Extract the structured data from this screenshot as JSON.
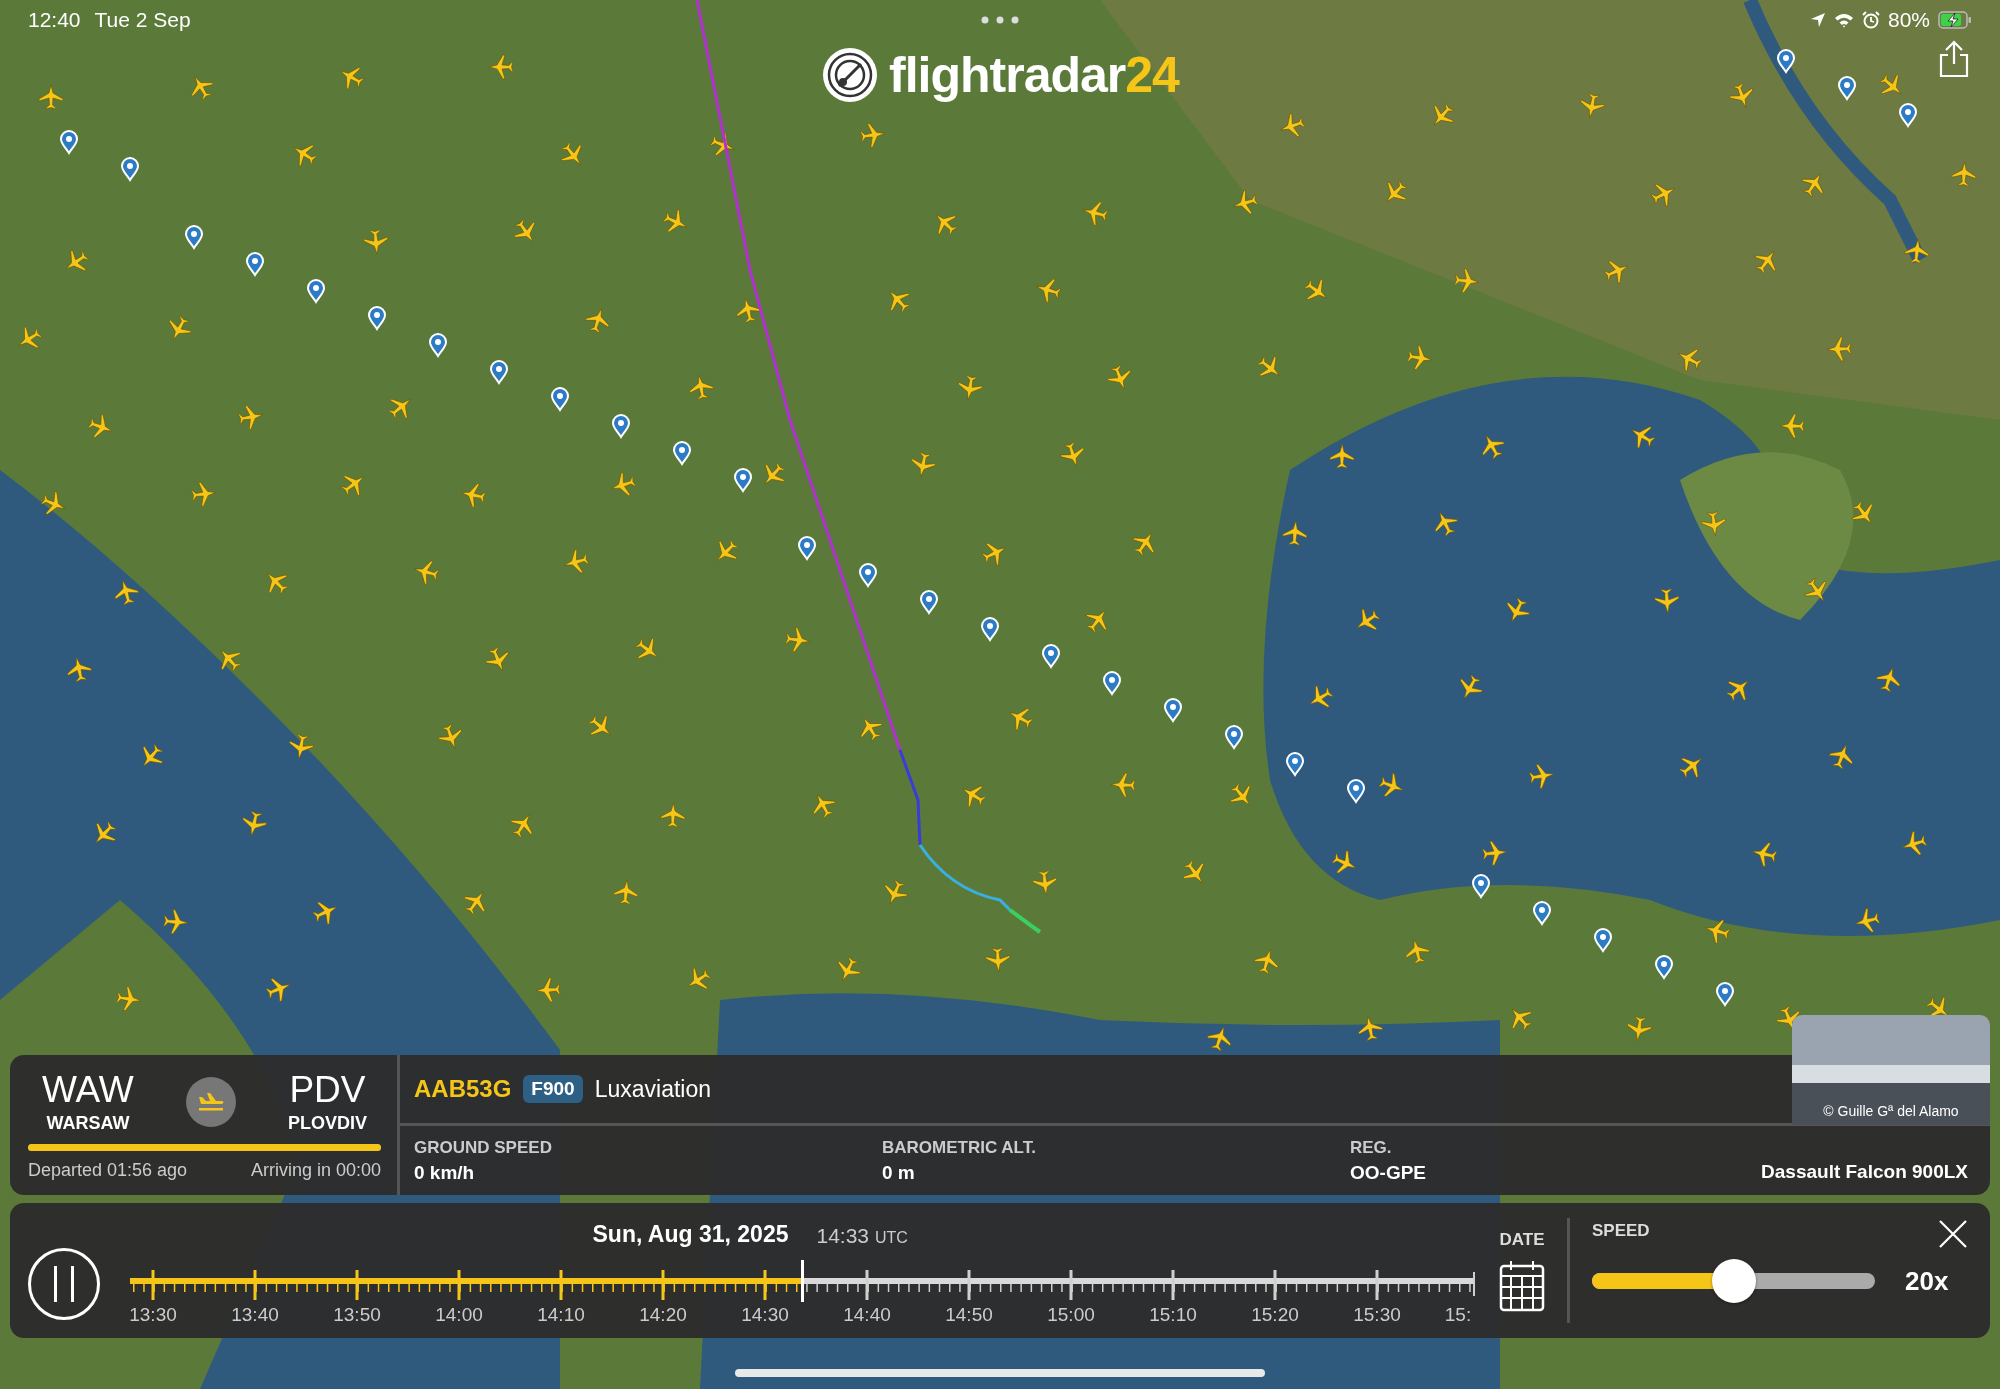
{
  "status_bar": {
    "time": "12:40",
    "date": "Tue 2 Sep",
    "battery": "80%",
    "charging": true
  },
  "logo": {
    "name": "flightradar",
    "number": "24"
  },
  "flight": {
    "origin": {
      "code": "WAW",
      "city": "WARSAW"
    },
    "destination": {
      "code": "PDV",
      "city": "PLOVDIV"
    },
    "progress": {
      "level": 1
    },
    "departed": "Departed 01:56 ago",
    "arriving": "Arriving in 00:00",
    "callsign": "AAB53G",
    "type_badge": "F900",
    "airline": "Luxaviation",
    "stats": [
      {
        "label": "GROUND SPEED",
        "value": "0 km/h"
      },
      {
        "label": "BAROMETRIC ALT.",
        "value": "0 m"
      },
      {
        "label": "REG.",
        "value": "OO-GPE"
      }
    ],
    "aircraft": "Dassault Falcon 900LX",
    "photo_credit": "© Guille Gª del Alamo"
  },
  "playback": {
    "playing": true,
    "date": "Sun, Aug 31, 2025",
    "time": "14:33",
    "zone": "UTC",
    "timeline": {
      "level": 0.5
    },
    "ticks": [
      "13:30",
      "13:40",
      "13:50",
      "14:00",
      "14:10",
      "14:20",
      "14:30",
      "14:40",
      "14:50",
      "15:00",
      "15:10",
      "15:20",
      "15:30",
      "15:"
    ],
    "date_label": "DATE",
    "speed_label": "SPEED",
    "speed": {
      "level": 0.5
    },
    "speed_value": "20x"
  }
}
